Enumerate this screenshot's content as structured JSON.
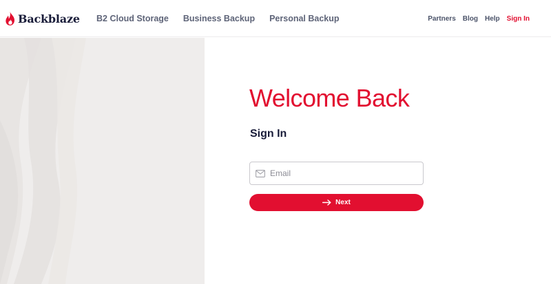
{
  "header": {
    "brand": "Backblaze",
    "nav_main": [
      {
        "label": "B2 Cloud Storage"
      },
      {
        "label": "Business Backup"
      },
      {
        "label": "Personal Backup"
      }
    ],
    "nav_right": [
      {
        "label": "Partners"
      },
      {
        "label": "Blog"
      },
      {
        "label": "Help"
      },
      {
        "label": "Sign In"
      }
    ]
  },
  "colors": {
    "accent": "#e20f30",
    "navy": "#1a1d3a",
    "panel": "#efedec"
  },
  "main": {
    "title": "Welcome Back",
    "subtitle": "Sign In",
    "email_placeholder": "Email",
    "email_value": "",
    "next_label": "Next"
  },
  "icons": {
    "logo": "flame-icon",
    "email": "envelope-icon",
    "next": "arrow-right-icon"
  }
}
